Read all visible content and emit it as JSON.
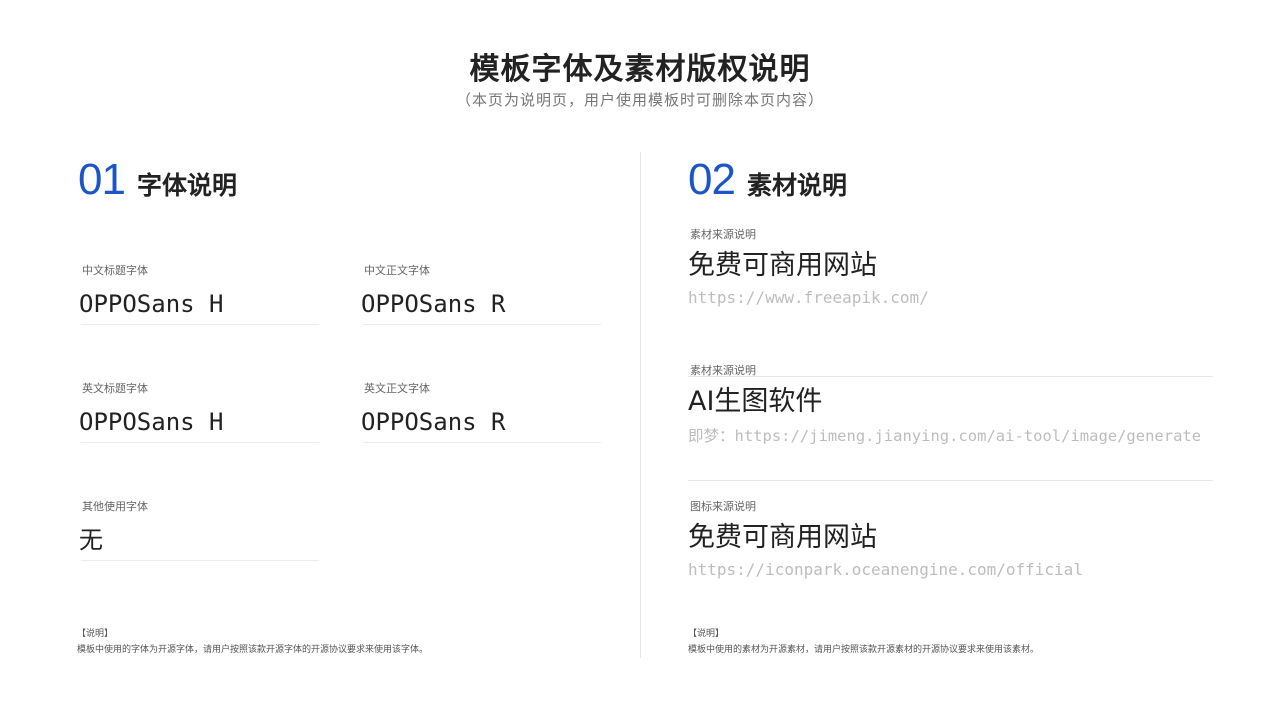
{
  "header": {
    "title": "模板字体及素材版权说明",
    "subtitle": "（本页为说明页，用户使用模板时可删除本页内容）"
  },
  "colors": {
    "accent": "#1a56c8",
    "text": "#222222",
    "muted": "#bdbdbd"
  },
  "fonts_section": {
    "number": "01",
    "title": "字体说明",
    "items": [
      {
        "label": "中文标题字体",
        "value": "OPPOSans H"
      },
      {
        "label": "中文正文字体",
        "value": "OPPOSans R"
      },
      {
        "label": "英文标题字体",
        "value": "OPPOSans H"
      },
      {
        "label": "英文正文字体",
        "value": "OPPOSans R"
      },
      {
        "label": "其他使用字体",
        "value": "无"
      }
    ],
    "note_title": "【说明】",
    "note_text": "模板中使用的字体为开源字体，请用户按照该款开源字体的开源协议要求来使用该字体。"
  },
  "materials_section": {
    "number": "02",
    "title": "素材说明",
    "items": [
      {
        "label": "素材来源说明",
        "name": "免费可商用网站",
        "url": "https://www.freeapik.com/"
      },
      {
        "label": "素材来源说明",
        "name": "AI生图软件",
        "url": "即梦：https://jimeng.jianying.com/ai-tool/image/generate"
      },
      {
        "label": "图标来源说明",
        "name": "免费可商用网站",
        "url": "https://iconpark.oceanengine.com/official"
      }
    ],
    "note_title": "【说明】",
    "note_text": "模板中使用的素材为开源素材，请用户按照该款开源素材的开源协议要求来使用该素材。"
  }
}
